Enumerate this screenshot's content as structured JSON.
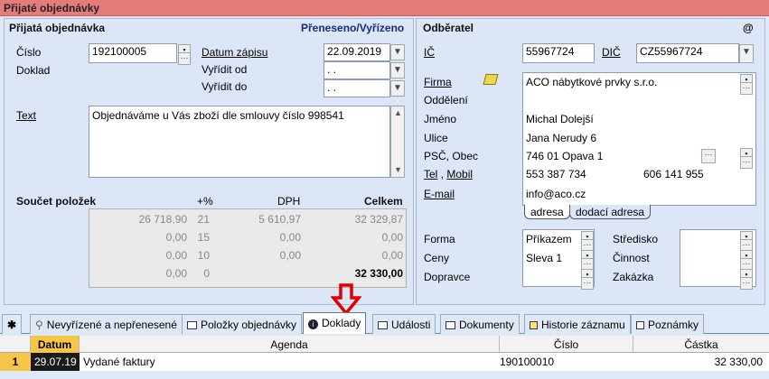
{
  "window": {
    "title": "Přijaté objednávky"
  },
  "order": {
    "header": "Přijatá objednávka",
    "status": "Přeneseno/Vyřízeno",
    "cislo_label": "Číslo",
    "cislo_value": "192100005",
    "doklad_label": "Doklad",
    "datum_zapisu_label": "Datum zápisu",
    "datum_zapisu_value": "22.09.2019",
    "vyridit_od_label": "Vyřídit od",
    "vyridit_od_value": " .  .",
    "vyridit_do_label": "Vyřídit do",
    "vyridit_do_value": " .  .",
    "text_label": "Text",
    "text_value": "Objednáváme u Vás zboží dle smlouvy číslo 998541"
  },
  "sum": {
    "title": "Součet položek",
    "col_pct": "+%",
    "col_dph": "DPH",
    "col_celkem": "Celkem",
    "rows": [
      {
        "base": "26 718,90",
        "pct": "21",
        "dph": "5 610,97",
        "total": "32 329,87"
      },
      {
        "base": "0,00",
        "pct": "15",
        "dph": "0,00",
        "total": "0,00"
      },
      {
        "base": "0,00",
        "pct": "10",
        "dph": "0,00",
        "total": "0,00"
      },
      {
        "base": "0,00",
        "pct": "0",
        "dph": "",
        "total": "32 330,00"
      }
    ]
  },
  "customer": {
    "header": "Odběratel",
    "at_symbol": "@",
    "ic_label": "IČ",
    "ic_value": "55967724",
    "dic_label": "DIČ",
    "dic_value": "CZ55967724",
    "firma_label": "Firma",
    "firma_value": "ACO nábytkové prvky s.r.o.",
    "oddeleni_label": "Oddělení",
    "jmeno_label": "Jméno",
    "jmeno_value": "Michal Dolejší",
    "ulice_label": "Ulice",
    "ulice_value": "Jana Nerudy 6",
    "psc_label": "PSČ, Obec",
    "psc_value": "746 01",
    "obec_value": "Opava 1",
    "tel_label": "Tel",
    "mobil_label": "Mobil",
    "tel_value": "553 387 734",
    "mobil_value": "606 141 955",
    "email_label": "E-mail",
    "email_value": "info@aco.cz",
    "addr_tabs": [
      "adresa",
      "dodací adresa"
    ]
  },
  "payment": {
    "forma_label": "Forma",
    "forma_value": "Příkazem",
    "ceny_label": "Ceny",
    "ceny_value": "Sleva 1",
    "dopravce_label": "Dopravce",
    "stredisko_label": "Středisko",
    "cinnost_label": "Činnost",
    "zakazka_label": "Zakázka"
  },
  "tabs": [
    {
      "label": "✱"
    },
    {
      "label": "Nevyřízené a nepřenesené"
    },
    {
      "label": "Položky objednávky"
    },
    {
      "label": "Doklady"
    },
    {
      "label": "Události"
    },
    {
      "label": "Dokumenty"
    },
    {
      "label": "Historie záznamu"
    },
    {
      "label": "Poznámky"
    }
  ],
  "grid": {
    "columns": [
      "Datum",
      "Agenda",
      "Číslo",
      "Částka"
    ],
    "rows": [
      {
        "num": "1",
        "datum": "29.07.19",
        "agenda": "Vydané faktury",
        "cislo": "190100010",
        "castka": "32 330,00"
      }
    ]
  },
  "colors": {
    "title_bar": "#e57c7c",
    "panel": "#dde6f6",
    "arrow": "#e00000",
    "status": "#1a2a80"
  }
}
